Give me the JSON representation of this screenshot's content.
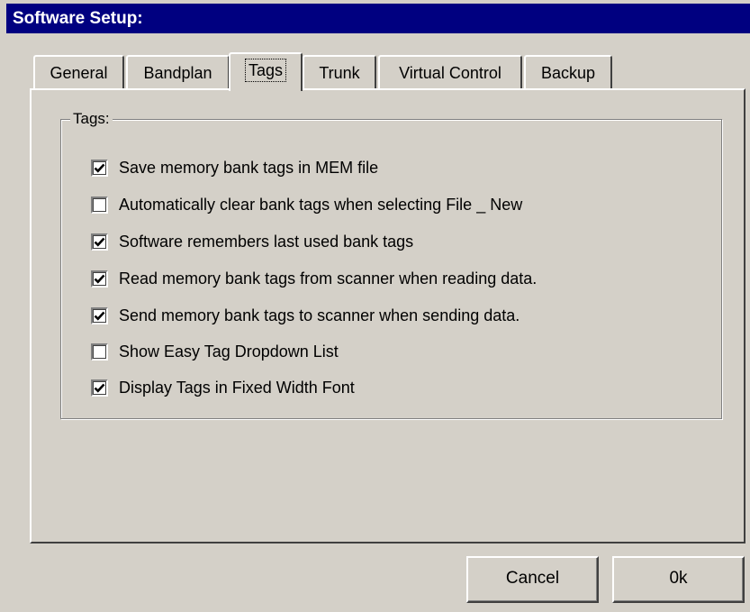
{
  "window": {
    "title": "Software Setup:"
  },
  "tabs": [
    {
      "label": "General",
      "active": false
    },
    {
      "label": "Bandplan",
      "active": false
    },
    {
      "label": "Tags",
      "active": true
    },
    {
      "label": "Trunk",
      "active": false
    },
    {
      "label": "Virtual Control",
      "active": false
    },
    {
      "label": "Backup",
      "active": false
    }
  ],
  "group": {
    "title": "Tags:"
  },
  "options": [
    {
      "label": "Save memory bank tags in MEM file",
      "checked": true
    },
    {
      "label": "Automatically clear bank tags when selecting File _ New",
      "checked": false
    },
    {
      "label": "Software remembers last used bank tags",
      "checked": true
    },
    {
      "label": "Read memory bank tags from scanner when reading data.",
      "checked": true
    },
    {
      "label": "Send memory bank tags to scanner when sending data.",
      "checked": true
    },
    {
      "label": "Show Easy Tag Dropdown List",
      "checked": false
    },
    {
      "label": "Display Tags in Fixed Width Font",
      "checked": true
    }
  ],
  "buttons": {
    "cancel": "Cancel",
    "ok": "0k"
  }
}
